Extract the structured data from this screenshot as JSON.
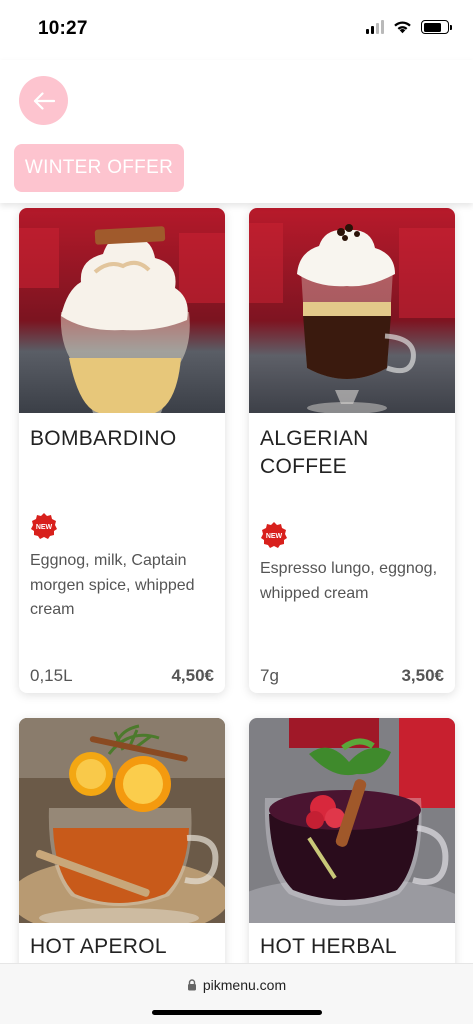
{
  "status": {
    "time": "10:27"
  },
  "header": {
    "category_chip": "WINTER OFFER"
  },
  "products": [
    {
      "title": "BOMBARDINO",
      "badge": "NEW",
      "description": "Eggnog, milk, Captain morgen spice, whipped cream",
      "size": "0,15L",
      "price": "4,50€"
    },
    {
      "title": "ALGERIAN COFFEE",
      "badge": "NEW",
      "description": "Espresso lungo, eggnog, whipped cream",
      "size": "7g",
      "price": "3,50€"
    },
    {
      "title": "HOT APEROL"
    },
    {
      "title": "HOT HERBAL"
    }
  ],
  "browser": {
    "url": "pikmenu.com"
  },
  "colors": {
    "accent_pink": "#fdc4cf",
    "badge_red": "#d8201c"
  }
}
